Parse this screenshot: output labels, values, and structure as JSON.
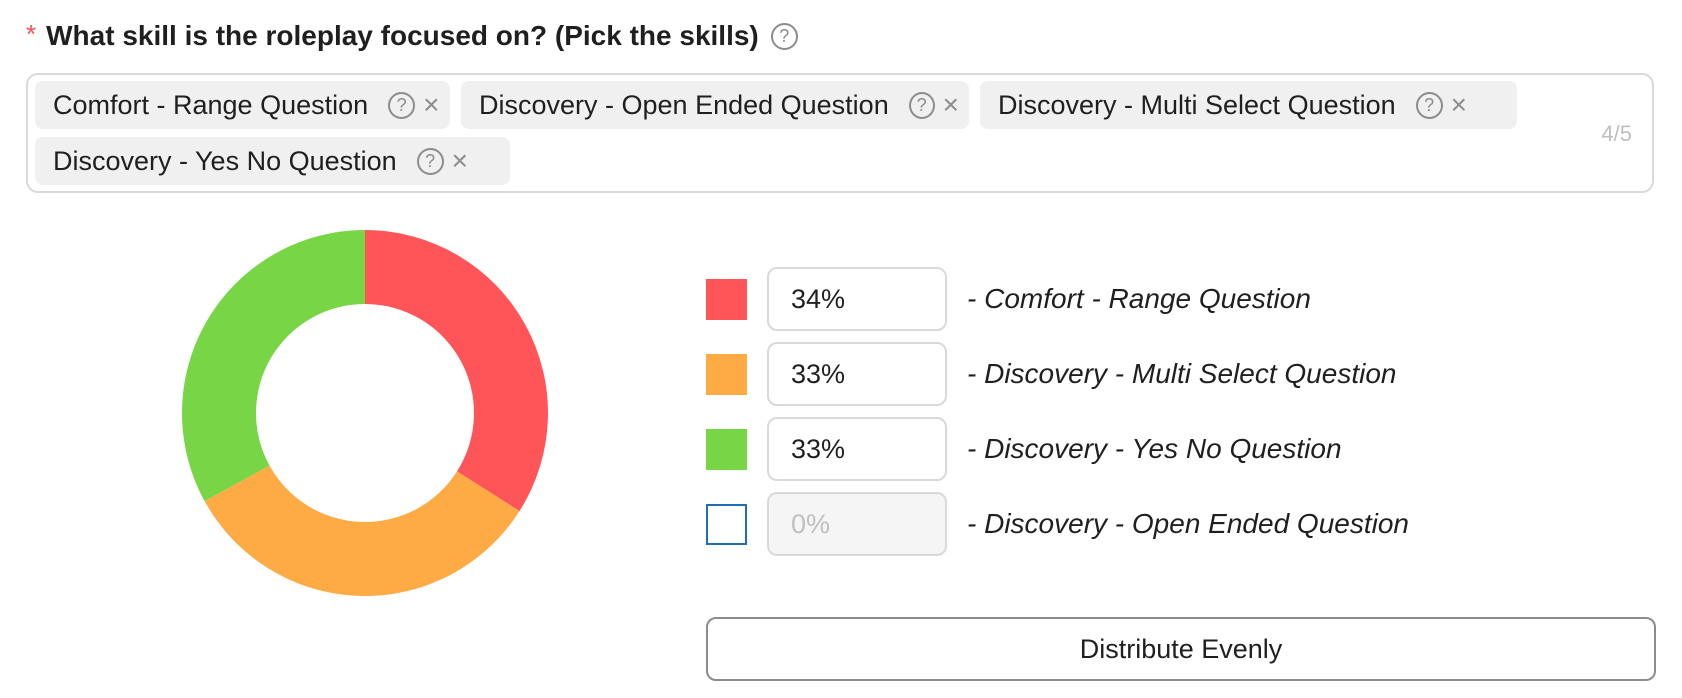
{
  "question": {
    "required_mark": "*",
    "label": "What skill is the roleplay focused on? (Pick the skills)",
    "help_icon": "?"
  },
  "select": {
    "tags": [
      {
        "label": "Comfort - Range Question",
        "help_icon": "?",
        "remove_icon": "×"
      },
      {
        "label": "Discovery - Open Ended Question",
        "help_icon": "?",
        "remove_icon": "×"
      },
      {
        "label": "Discovery - Multi Select Question",
        "help_icon": "?",
        "remove_icon": "×"
      },
      {
        "label": "Discovery - Yes No Question",
        "help_icon": "?",
        "remove_icon": "×"
      }
    ],
    "counter": "4/5"
  },
  "distribution": {
    "rows": [
      {
        "color": "#ff5558",
        "value": "34%",
        "label": "- Comfort - Range Question"
      },
      {
        "color": "#ffab45",
        "value": "33%",
        "label": "- Discovery - Multi Select Question"
      },
      {
        "color": "#78d545",
        "value": "33%",
        "label": "- Discovery - Yes No Question"
      },
      {
        "color": "#1f6fb5",
        "value": "0%",
        "label": "- Discovery - Open Ended Question"
      }
    ],
    "distribute_label": "Distribute Evenly"
  },
  "chart_data": {
    "type": "pie",
    "categories": [
      "Comfort - Range Question",
      "Discovery - Multi Select Question",
      "Discovery - Yes No Question",
      "Discovery - Open Ended Question"
    ],
    "values": [
      34,
      33,
      33,
      0
    ],
    "colors": [
      "#ff5558",
      "#ffab45",
      "#78d545",
      "#1f6fb5"
    ],
    "donut": true
  }
}
